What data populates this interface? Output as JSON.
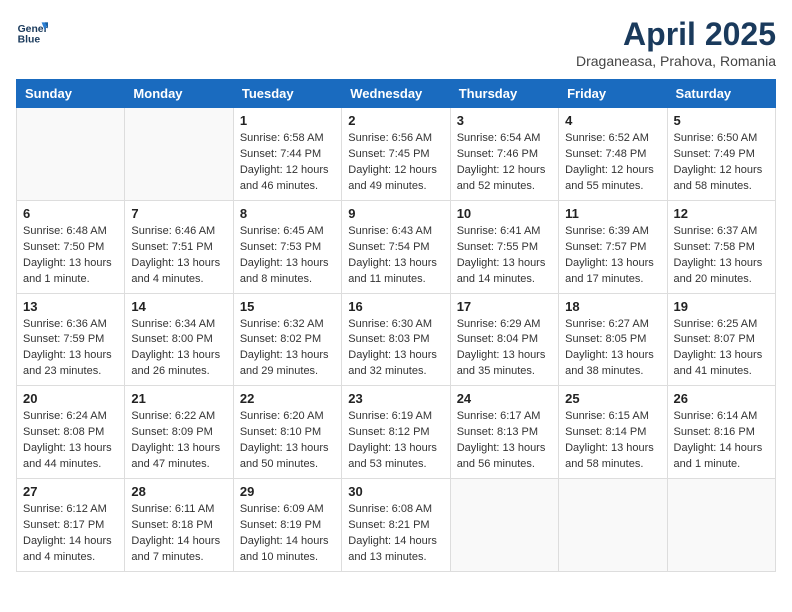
{
  "header": {
    "logo_line1": "General",
    "logo_line2": "Blue",
    "month_title": "April 2025",
    "location": "Draganeasa, Prahova, Romania"
  },
  "days_of_week": [
    "Sunday",
    "Monday",
    "Tuesday",
    "Wednesday",
    "Thursday",
    "Friday",
    "Saturday"
  ],
  "weeks": [
    [
      {
        "day": "",
        "info": ""
      },
      {
        "day": "",
        "info": ""
      },
      {
        "day": "1",
        "info": "Sunrise: 6:58 AM\nSunset: 7:44 PM\nDaylight: 12 hours and 46 minutes."
      },
      {
        "day": "2",
        "info": "Sunrise: 6:56 AM\nSunset: 7:45 PM\nDaylight: 12 hours and 49 minutes."
      },
      {
        "day": "3",
        "info": "Sunrise: 6:54 AM\nSunset: 7:46 PM\nDaylight: 12 hours and 52 minutes."
      },
      {
        "day": "4",
        "info": "Sunrise: 6:52 AM\nSunset: 7:48 PM\nDaylight: 12 hours and 55 minutes."
      },
      {
        "day": "5",
        "info": "Sunrise: 6:50 AM\nSunset: 7:49 PM\nDaylight: 12 hours and 58 minutes."
      }
    ],
    [
      {
        "day": "6",
        "info": "Sunrise: 6:48 AM\nSunset: 7:50 PM\nDaylight: 13 hours and 1 minute."
      },
      {
        "day": "7",
        "info": "Sunrise: 6:46 AM\nSunset: 7:51 PM\nDaylight: 13 hours and 4 minutes."
      },
      {
        "day": "8",
        "info": "Sunrise: 6:45 AM\nSunset: 7:53 PM\nDaylight: 13 hours and 8 minutes."
      },
      {
        "day": "9",
        "info": "Sunrise: 6:43 AM\nSunset: 7:54 PM\nDaylight: 13 hours and 11 minutes."
      },
      {
        "day": "10",
        "info": "Sunrise: 6:41 AM\nSunset: 7:55 PM\nDaylight: 13 hours and 14 minutes."
      },
      {
        "day": "11",
        "info": "Sunrise: 6:39 AM\nSunset: 7:57 PM\nDaylight: 13 hours and 17 minutes."
      },
      {
        "day": "12",
        "info": "Sunrise: 6:37 AM\nSunset: 7:58 PM\nDaylight: 13 hours and 20 minutes."
      }
    ],
    [
      {
        "day": "13",
        "info": "Sunrise: 6:36 AM\nSunset: 7:59 PM\nDaylight: 13 hours and 23 minutes."
      },
      {
        "day": "14",
        "info": "Sunrise: 6:34 AM\nSunset: 8:00 PM\nDaylight: 13 hours and 26 minutes."
      },
      {
        "day": "15",
        "info": "Sunrise: 6:32 AM\nSunset: 8:02 PM\nDaylight: 13 hours and 29 minutes."
      },
      {
        "day": "16",
        "info": "Sunrise: 6:30 AM\nSunset: 8:03 PM\nDaylight: 13 hours and 32 minutes."
      },
      {
        "day": "17",
        "info": "Sunrise: 6:29 AM\nSunset: 8:04 PM\nDaylight: 13 hours and 35 minutes."
      },
      {
        "day": "18",
        "info": "Sunrise: 6:27 AM\nSunset: 8:05 PM\nDaylight: 13 hours and 38 minutes."
      },
      {
        "day": "19",
        "info": "Sunrise: 6:25 AM\nSunset: 8:07 PM\nDaylight: 13 hours and 41 minutes."
      }
    ],
    [
      {
        "day": "20",
        "info": "Sunrise: 6:24 AM\nSunset: 8:08 PM\nDaylight: 13 hours and 44 minutes."
      },
      {
        "day": "21",
        "info": "Sunrise: 6:22 AM\nSunset: 8:09 PM\nDaylight: 13 hours and 47 minutes."
      },
      {
        "day": "22",
        "info": "Sunrise: 6:20 AM\nSunset: 8:10 PM\nDaylight: 13 hours and 50 minutes."
      },
      {
        "day": "23",
        "info": "Sunrise: 6:19 AM\nSunset: 8:12 PM\nDaylight: 13 hours and 53 minutes."
      },
      {
        "day": "24",
        "info": "Sunrise: 6:17 AM\nSunset: 8:13 PM\nDaylight: 13 hours and 56 minutes."
      },
      {
        "day": "25",
        "info": "Sunrise: 6:15 AM\nSunset: 8:14 PM\nDaylight: 13 hours and 58 minutes."
      },
      {
        "day": "26",
        "info": "Sunrise: 6:14 AM\nSunset: 8:16 PM\nDaylight: 14 hours and 1 minute."
      }
    ],
    [
      {
        "day": "27",
        "info": "Sunrise: 6:12 AM\nSunset: 8:17 PM\nDaylight: 14 hours and 4 minutes."
      },
      {
        "day": "28",
        "info": "Sunrise: 6:11 AM\nSunset: 8:18 PM\nDaylight: 14 hours and 7 minutes."
      },
      {
        "day": "29",
        "info": "Sunrise: 6:09 AM\nSunset: 8:19 PM\nDaylight: 14 hours and 10 minutes."
      },
      {
        "day": "30",
        "info": "Sunrise: 6:08 AM\nSunset: 8:21 PM\nDaylight: 14 hours and 13 minutes."
      },
      {
        "day": "",
        "info": ""
      },
      {
        "day": "",
        "info": ""
      },
      {
        "day": "",
        "info": ""
      }
    ]
  ]
}
